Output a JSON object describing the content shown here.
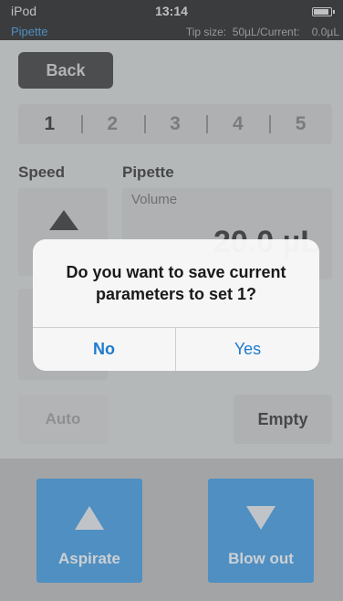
{
  "status_bar": {
    "device": "iPod",
    "time": "13:14",
    "mode": "Pipette",
    "tip_info": "Tip size:  50µL/Current:    0.0µL"
  },
  "nav": {
    "back_label": "Back"
  },
  "sets": [
    "1",
    "2",
    "3",
    "4",
    "5"
  ],
  "labels": {
    "speed": "Speed",
    "pipette": "Pipette",
    "volume": "Volume",
    "volume_value": "20.0 µL"
  },
  "controls": {
    "auto_label": "Auto",
    "empty_label": "Empty"
  },
  "actions": {
    "aspirate_label": "Aspirate",
    "blowout_label": "Blow out"
  },
  "alert": {
    "message": "Do you want to save current parameters to set 1?",
    "no_label": "No",
    "yes_label": "Yes"
  },
  "colors": {
    "accent": "#2b8ad6",
    "alert_button": "#1e7ad0"
  }
}
